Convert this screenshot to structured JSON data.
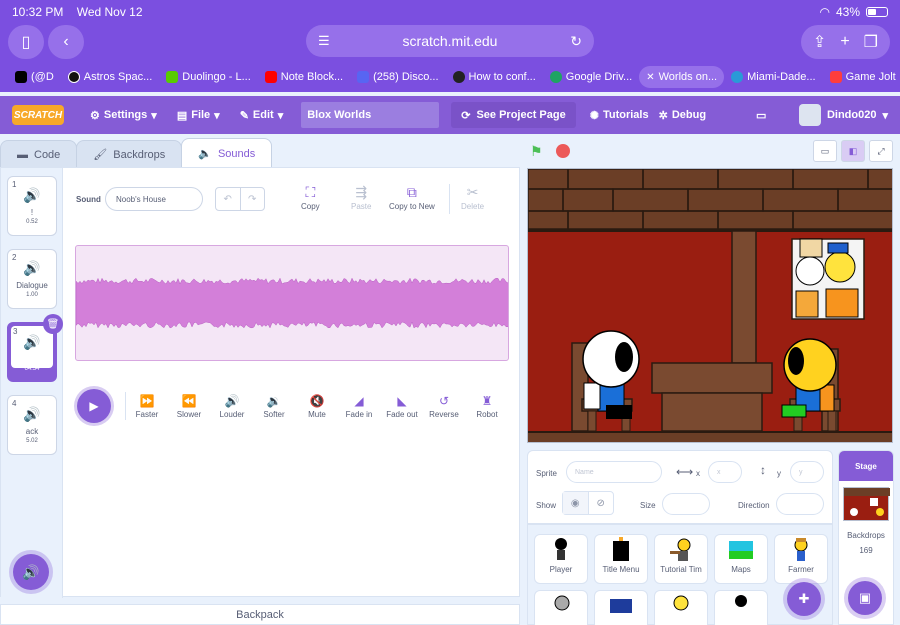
{
  "status": {
    "time": "10:32 PM",
    "date": "Wed Nov 12",
    "battery": "43%"
  },
  "browser": {
    "url": "scratch.mit.edu",
    "tabs": [
      {
        "label": "(@D",
        "color": "#000000"
      },
      {
        "label": "Astros Spac...",
        "color": "#111111"
      },
      {
        "label": "Duolingo - L...",
        "color": "#58cc02"
      },
      {
        "label": "Note Block...",
        "color": "#ff0000"
      },
      {
        "label": "(258) Disco...",
        "color": "#5865f2"
      },
      {
        "label": "How to conf...",
        "color": "#222222"
      },
      {
        "label": "Google Driv...",
        "color": "#1fa463"
      },
      {
        "label": "Worlds on...",
        "color": "#ffffff"
      },
      {
        "label": "Miami-Dade...",
        "color": "#2a9ad7"
      },
      {
        "label": "Game Jolt",
        "color": "#ff3d3d"
      }
    ]
  },
  "menubar": {
    "logo": "SCRATCH",
    "settings": "Settings",
    "file": "File",
    "edit": "Edit",
    "project_title": "Blox Worlds",
    "see_project": "See Project Page",
    "tutorials": "Tutorials",
    "debug": "Debug",
    "username": "Dindo020"
  },
  "editor_tabs": {
    "code": "Code",
    "backdrops": "Backdrops",
    "sounds": "Sounds"
  },
  "sounds": [
    {
      "num": "1",
      "name": "!",
      "duration": "0.52"
    },
    {
      "num": "2",
      "name": "Dialogue",
      "duration": "1.00"
    },
    {
      "num": "3",
      "name": "Noob's H...",
      "duration": "64.34"
    },
    {
      "num": "4",
      "name": "ack",
      "duration": "5.02"
    }
  ],
  "sound_editor": {
    "sound_label": "Sound",
    "sound_name": "Noob's House",
    "copy": "Copy",
    "paste": "Paste",
    "copy_to_new": "Copy to New",
    "delete": "Delete",
    "effects": [
      "Faster",
      "Slower",
      "Louder",
      "Softer",
      "Mute",
      "Fade in",
      "Fade out",
      "Reverse",
      "Robot"
    ]
  },
  "backpack": "Backpack",
  "sprite_info": {
    "sprite_label": "Sprite",
    "name_placeholder": "Name",
    "x_label": "x",
    "y_label": "y",
    "x_placeholder": "x",
    "y_placeholder": "y",
    "show_label": "Show",
    "size_label": "Size",
    "direction_label": "Direction"
  },
  "sprites": [
    "Player",
    "Title Menu",
    "Tutorial Tim",
    "Maps",
    "Farmer"
  ],
  "stage_pane": {
    "title": "Stage",
    "backdrops_label": "Backdrops",
    "backdrops_count": "169"
  },
  "colors": {
    "accent": "#855cd6",
    "chrome": "#7b4fe0",
    "stage_wall": "#9a1e11",
    "waveform": "#d37fd9"
  }
}
